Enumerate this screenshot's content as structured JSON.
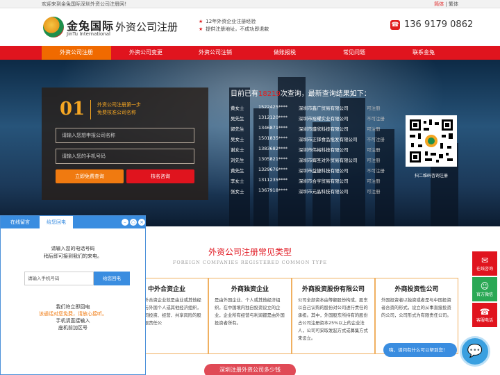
{
  "topbar": {
    "welcome": "欢迎来到金兔国际深圳外资公司注册网！",
    "lang_simplified": "简体",
    "lang_traditional": "繁体"
  },
  "header": {
    "logo_cn": "金兔国际",
    "logo_en": "JinTu International",
    "site_title": "外资公司注册",
    "slogans": [
      "12年外资企业注册经验",
      "提供注册地址，不成功即退款"
    ],
    "phone": "136 9179 0862"
  },
  "nav": {
    "items": [
      "外资公司注册",
      "外资公司变更",
      "外资公司注销",
      "做账报税",
      "常见问题",
      "联系金兔"
    ],
    "active_index": 0
  },
  "form": {
    "step_number": "01",
    "step_text": [
      "外资公司注册第一步",
      "免费核准公司名称"
    ],
    "input1_placeholder": "请输入您想申报公司名称",
    "input2_placeholder": "请输入您的手机号码",
    "btn_query": "立即免费查询",
    "btn_names": "核名咨询"
  },
  "query": {
    "head_prefix": "目前已有",
    "count": "18219",
    "head_suffix": "次查询，最新查询结果如下：",
    "rows": [
      [
        "黄女士",
        "1522425****",
        "深圳市鑫广贸易有限公司",
        "可注册"
      ],
      [
        "吴先生",
        "1312120****",
        "深圳市裕耀实业有限公司",
        "不可注册"
      ],
      [
        "郭先生",
        "1346871****",
        "深圳市盛欣科技有限公司",
        "可注册"
      ],
      [
        "吴女士",
        "1501835****",
        "深圳市正铎食品批发有限公司",
        "不可注册"
      ],
      [
        "谢女士",
        "1383682****",
        "深圳市伟裕科技有限公司",
        "可注册"
      ],
      [
        "刘先生",
        "1305821****",
        "深圳市辉圣对外贸易有限公司",
        "可注册"
      ],
      [
        "黄先生",
        "1329676****",
        "深圳市益捷科技有限公司",
        "不可注册"
      ],
      [
        "李女士",
        "1311235****",
        "深圳市合亨贸易有限公司",
        "可注册"
      ],
      [
        "张女士",
        "1367918****",
        "深圳市元晶科技有限公司",
        "可注册"
      ]
    ],
    "qr_label": "扫二维码咨询注册"
  },
  "section": {
    "title": "外资公司注册常见类型",
    "subtitle": "FOREIGN COMPANIES REGISTERED COMMON TYPE",
    "cards": [
      {
        "title": "中外合资企业",
        "body": "说，中外合资企业就是由业或其他经济组织与外国个人或其他经济组织，在内共同投资、经营、共享风险的股份式有限责任公"
      },
      {
        "title": "外商独资企业",
        "body": "是由外国企业、个人或其他经济组织，在中国境内独自投资设立的企业，企业所有经营与利润都是由外国投资者所有。"
      },
      {
        "title": "外商投资股份有限公司",
        "body": "公司全部资本由等额股份构成，股东以自己认购的股份对公司进行责任的承担。其中，外国股东所持有的股份占公司注册资本25%以上的企业法人，公司可采取发起方式或募集方式来设立。"
      },
      {
        "title": "外商投资性公司",
        "body": "外国投资者以独资或者是与中国投资者合资的形式，设立的从事直接投资的公司，公司形式为有限责任公司。"
      }
    ],
    "bottom_btn": "深圳注册外资公司多少钱"
  },
  "chat": {
    "tab1": "在线留言",
    "tab2": "给您回电",
    "prompt": [
      "请输入您的电话号码",
      "稍后即可接到我们的来电。"
    ],
    "input_placeholder": "请输入手机号码",
    "call_btn": "给您回电",
    "promise": [
      "我们符立即回电",
      "该通话对您免费，请放心接听。",
      "手机请直接输入",
      "座机前加区号"
    ]
  },
  "side": {
    "items": [
      "在线咨询",
      "官方微信",
      "客服电话"
    ]
  },
  "bubble": "嗨，请问有什么可以帮到您！"
}
